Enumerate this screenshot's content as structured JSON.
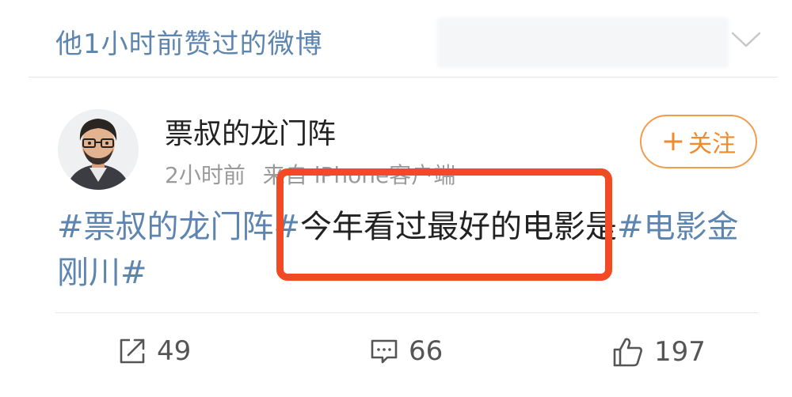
{
  "header": {
    "title": "他1小时前赞过的微博"
  },
  "post": {
    "author": "票叔的龙门阵",
    "time": "2小时前",
    "source": "来自 iPhone客户端",
    "follow_label": "关注",
    "text_parts": {
      "topic1": "#票叔的龙门阵#",
      "body": "今年看过最好的电影是",
      "topic2": "#电影金刚川#"
    }
  },
  "actions": {
    "repost_count": "49",
    "comment_count": "66",
    "like_count": "197"
  },
  "colors": {
    "link_blue": "#5d85b0",
    "follow_orange": "#f08a2c",
    "highlight_red": "#f14a24"
  },
  "icons": [
    "chevron-down-icon",
    "avatar",
    "plus-icon",
    "repost-icon",
    "comment-icon",
    "like-icon"
  ]
}
